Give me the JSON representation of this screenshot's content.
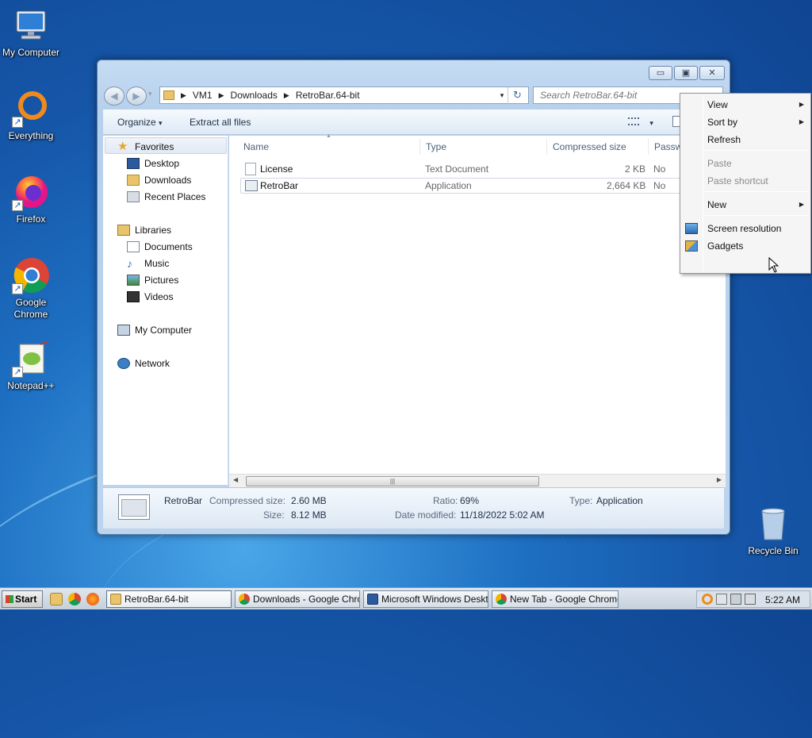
{
  "desktop": {
    "icons": [
      {
        "label": "My Computer"
      },
      {
        "label": "Everything"
      },
      {
        "label": "Firefox"
      },
      {
        "label": "Google Chrome"
      },
      {
        "label": "Notepad++"
      },
      {
        "label": "Recycle Bin"
      }
    ],
    "shortcut_glyph": "↗"
  },
  "window": {
    "controls": {
      "minimize": "▭",
      "maximize": "▣",
      "close": "✕"
    },
    "nav": {
      "back": "◀",
      "forward": "▶",
      "dropdown": "▾"
    },
    "breadcrumb": [
      "VM1",
      "Downloads",
      "RetroBar.64-bit"
    ],
    "breadcrumb_sep": "▶",
    "refresh": "↻",
    "search": {
      "placeholder": "Search RetroBar.64-bit"
    },
    "toolbar": {
      "organize": "Organize",
      "organize_arrow": "▾",
      "extract": "Extract all files",
      "view_arrow": "▾"
    },
    "navpane": {
      "favorites": "Favorites",
      "favorites_items": [
        "Desktop",
        "Downloads",
        "Recent Places"
      ],
      "libraries": "Libraries",
      "libraries_items": [
        "Documents",
        "Music",
        "Pictures",
        "Videos"
      ],
      "my_computer": "My Computer",
      "network": "Network"
    },
    "columns": {
      "name": "Name",
      "type": "Type",
      "compressed": "Compressed size",
      "password": "Passw"
    },
    "sort_indicator": "▲",
    "files": [
      {
        "name": "License",
        "type": "Text Document",
        "compressed": "2 KB",
        "password": "No"
      },
      {
        "name": "RetroBar",
        "type": "Application",
        "compressed": "2,664 KB",
        "password": "No"
      }
    ],
    "scroll": {
      "left": "◀",
      "right": "▶",
      "grip": "|||"
    },
    "details": {
      "name": "RetroBar",
      "compressed_label": "Compressed size:",
      "compressed_value": "2.60 MB",
      "size_label": "Size:",
      "size_value": "8.12 MB",
      "ratio_label": "Ratio:",
      "ratio_value": "69%",
      "modified_label": "Date modified:",
      "modified_value": "11/18/2022 5:02 AM",
      "type_label": "Type:",
      "type_value": "Application"
    }
  },
  "context_menu": {
    "items": [
      {
        "label": "View",
        "submenu": true
      },
      {
        "label": "Sort by",
        "submenu": true
      },
      {
        "label": "Refresh"
      },
      {
        "label": "Paste",
        "disabled": true
      },
      {
        "label": "Paste shortcut",
        "disabled": true
      },
      {
        "label": "New",
        "submenu": true
      },
      {
        "label": "Screen resolution"
      },
      {
        "label": "Gadgets"
      }
    ],
    "submenu_arrow": "▶"
  },
  "taskbar": {
    "start": "Start",
    "tasks": [
      {
        "label": "RetroBar.64-bit"
      },
      {
        "label": "Downloads - Google Chro..."
      },
      {
        "label": "Microsoft Windows Deskt..."
      },
      {
        "label": "New Tab - Google Chrome"
      }
    ],
    "clock": "5:22 AM"
  },
  "colors": {
    "accent": "#1d6fc2",
    "selection": "#d0d8e4",
    "chrome_red": "#db4437",
    "chrome_green": "#0f9d58",
    "chrome_yellow": "#f4b400"
  }
}
